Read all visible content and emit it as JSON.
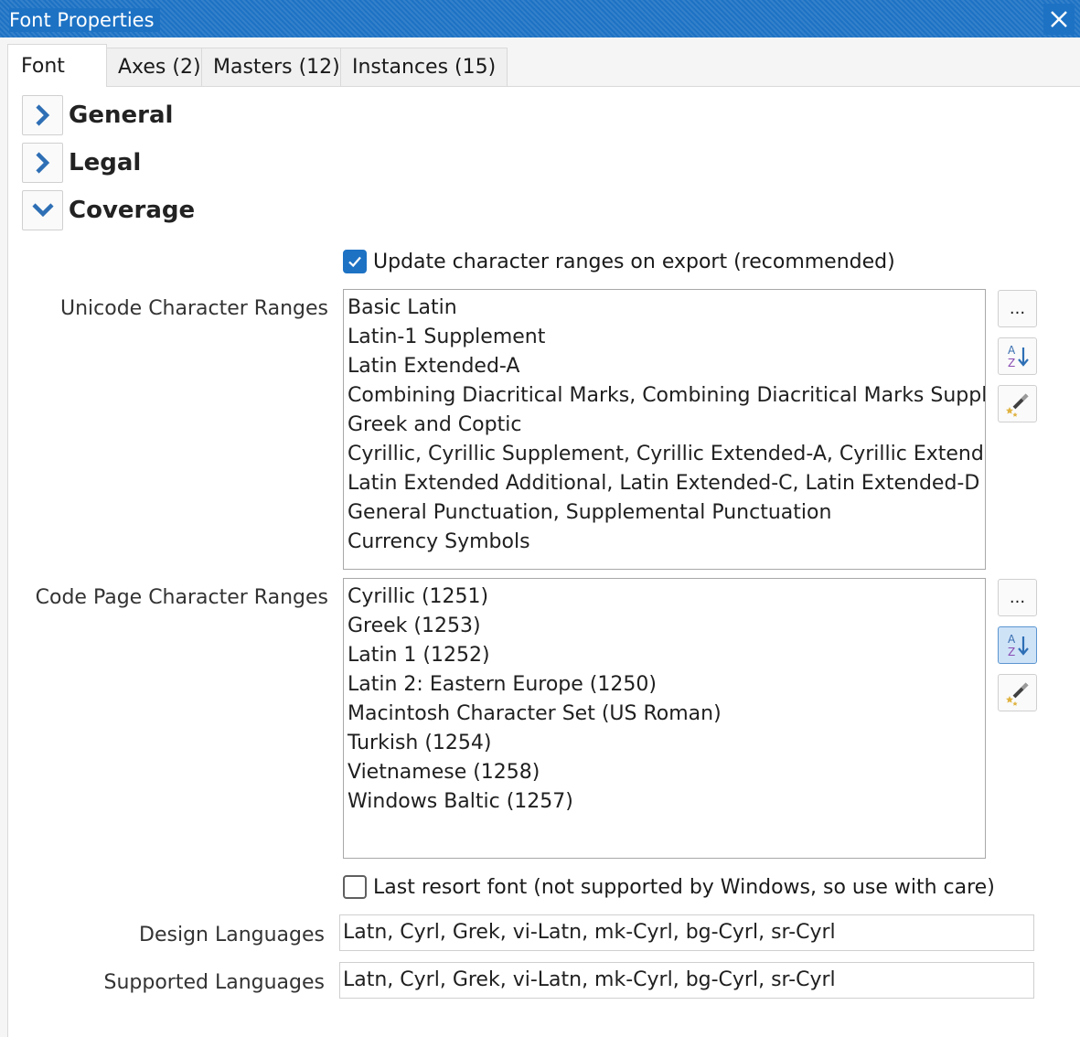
{
  "window": {
    "title": "Font Properties"
  },
  "tabs": [
    {
      "label": "Font",
      "active": true
    },
    {
      "label": "Axes (2)",
      "active": false
    },
    {
      "label": "Masters (12)",
      "active": false
    },
    {
      "label": "Instances (15)",
      "active": false
    }
  ],
  "sections": [
    {
      "label": "General",
      "expanded": false,
      "icon": "chevron-right-icon"
    },
    {
      "label": "Legal",
      "expanded": false,
      "icon": "chevron-right-icon"
    },
    {
      "label": "Coverage",
      "expanded": true,
      "icon": "chevron-down-icon"
    }
  ],
  "coverage": {
    "update_ranges": {
      "label": "Update character ranges on export (recommended)",
      "checked": true
    },
    "unicode_ranges": {
      "label": "Unicode Character Ranges",
      "items": [
        "Basic Latin",
        "Latin-1 Supplement",
        "Latin Extended-A",
        "Combining Diacritical Marks, Combining Diacritical Marks Supplement",
        "Greek and Coptic",
        "Cyrillic, Cyrillic Supplement, Cyrillic Extended-A, Cyrillic Extended-B",
        "Latin Extended Additional, Latin Extended-C, Latin Extended-D",
        "General Punctuation, Supplemental Punctuation",
        "Currency Symbols"
      ]
    },
    "codepage_ranges": {
      "label": "Code Page Character Ranges",
      "items": [
        "Cyrillic (1251)",
        "Greek (1253)",
        "Latin 1 (1252)",
        "Latin 2: Eastern Europe (1250)",
        "Macintosh Character Set (US Roman)",
        "Turkish (1254)",
        "Vietnamese (1258)",
        "Windows Baltic (1257)"
      ]
    },
    "side_buttons": {
      "ellipsis_label": "..."
    },
    "last_resort": {
      "label": "Last resort font (not supported by Windows, so use with care)",
      "checked": false
    },
    "design_languages": {
      "label": "Design Languages",
      "value": "Latn, Cyrl, Grek, vi-Latn, mk-Cyrl, bg-Cyrl, sr-Cyrl"
    },
    "supported_languages": {
      "label": "Supported Languages",
      "value": "Latn, Cyrl, Grek, vi-Latn, mk-Cyrl, bg-Cyrl, sr-Cyrl"
    }
  },
  "colors": {
    "accent": "#1d72c4",
    "pressed": "#cfe3f7"
  }
}
